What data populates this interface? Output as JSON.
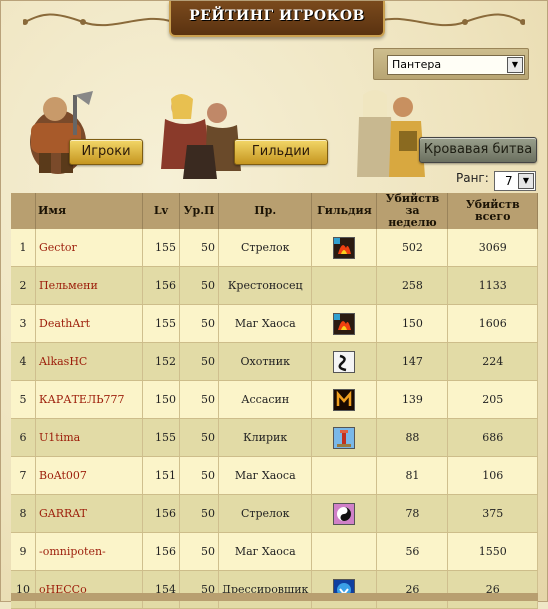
{
  "header": {
    "title": "РЕЙТИНГ ИГРОКОВ"
  },
  "server_select": {
    "value": "Пантера"
  },
  "tabs": [
    {
      "label": "Игроки"
    },
    {
      "label": "Гильдии"
    },
    {
      "label": "Кровавая битва"
    }
  ],
  "rank": {
    "label": "Ранг:",
    "value": "7"
  },
  "table": {
    "headers": [
      "",
      "Имя",
      "Lv",
      "Ур.П",
      "Пр.",
      "Гильдия",
      "Убийств за неделю",
      "Убийств всего"
    ],
    "rows": [
      {
        "n": "1",
        "name": "Gector",
        "lv": "155",
        "up": "50",
        "prof": "Стрелок",
        "guild_icon": "guild-fire",
        "week": "502",
        "total": "3069"
      },
      {
        "n": "2",
        "name": "Пельмени",
        "lv": "156",
        "up": "50",
        "prof": "Крестоносец",
        "guild_icon": "",
        "week": "258",
        "total": "1133"
      },
      {
        "n": "3",
        "name": "DeathArt",
        "lv": "155",
        "up": "50",
        "prof": "Маг Хаоса",
        "guild_icon": "guild-fire",
        "week": "150",
        "total": "1606"
      },
      {
        "n": "4",
        "name": "AlkasHC",
        "lv": "152",
        "up": "50",
        "prof": "Охотник",
        "guild_icon": "guild-serpent",
        "week": "147",
        "total": "224"
      },
      {
        "n": "5",
        "name": "КАРАТЕЛЬ777",
        "lv": "150",
        "up": "50",
        "prof": "Ассасин",
        "guild_icon": "guild-m-rune",
        "week": "139",
        "total": "205"
      },
      {
        "n": "6",
        "name": "U1tima",
        "lv": "155",
        "up": "50",
        "prof": "Клирик",
        "guild_icon": "guild-tower",
        "week": "88",
        "total": "686"
      },
      {
        "n": "7",
        "name": "BoAt007",
        "lv": "151",
        "up": "50",
        "prof": "Маг Хаоса",
        "guild_icon": "",
        "week": "81",
        "total": "106"
      },
      {
        "n": "8",
        "name": "GARRAT",
        "lv": "156",
        "up": "50",
        "prof": "Стрелок",
        "guild_icon": "guild-swirl",
        "week": "78",
        "total": "375"
      },
      {
        "n": "9",
        "name": "-omnipoten-",
        "lv": "156",
        "up": "50",
        "prof": "Маг Хаоса",
        "guild_icon": "",
        "week": "56",
        "total": "1550"
      },
      {
        "n": "10",
        "name": "оНЕССо",
        "lv": "154",
        "up": "50",
        "prof": "Дрессировщик",
        "guild_icon": "guild-blue-crest",
        "week": "26",
        "total": "26"
      }
    ]
  }
}
